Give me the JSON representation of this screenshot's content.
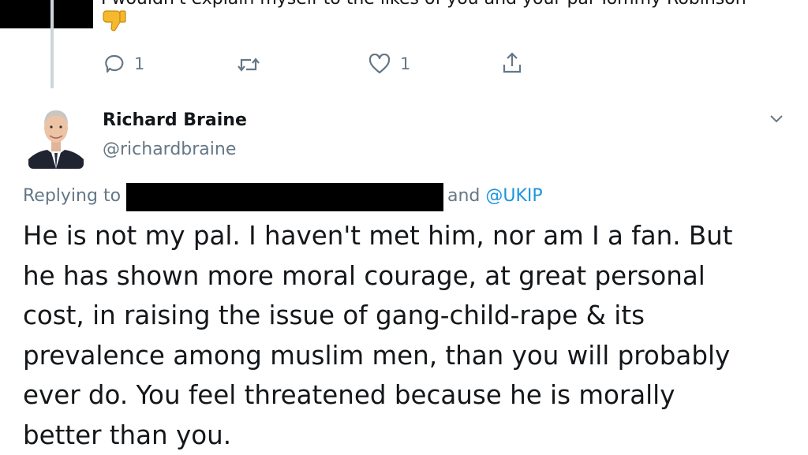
{
  "previous_tweet": {
    "text": "I wouldn't explain myself to the likes of you and your pal Tommy Robinson",
    "emoji": "thumbs-down",
    "actions": {
      "reply_count": "1",
      "like_count": "1"
    }
  },
  "tweet": {
    "author_name": "Richard Braine",
    "author_handle": "@richardbraine",
    "replying_prefix": "Replying to",
    "replying_and": "and",
    "replying_mention": "@UKIP",
    "body_lines": [
      "He is not my pal. I haven't met him, nor am I a fan. But",
      "he has shown more moral courage, at great personal",
      "cost, in raising the issue of gang-child-rape & its",
      "prevalence among muslim men, than you will probably",
      "ever do. You feel threatened because he is morally",
      "better than you."
    ]
  },
  "colors": {
    "text": "#14171a",
    "secondary": "#657786",
    "link": "#1b95e0",
    "thread_line": "#ccd6dd"
  }
}
